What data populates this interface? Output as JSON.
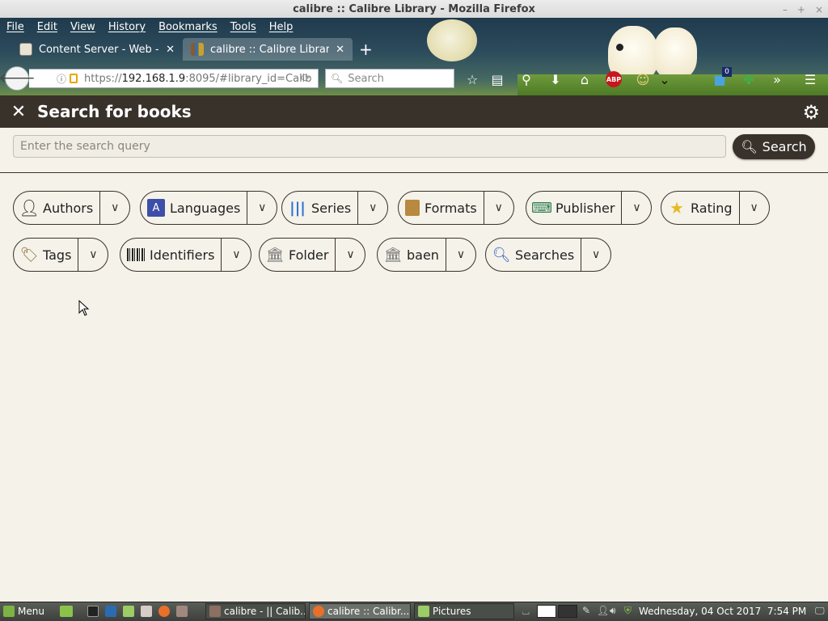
{
  "window": {
    "title": "calibre :: Calibre Library - Mozilla Firefox",
    "controls": [
      "–",
      "+",
      "×"
    ]
  },
  "menu": [
    "File",
    "Edit",
    "View",
    "History",
    "Bookmarks",
    "Tools",
    "Help"
  ],
  "tabs": [
    {
      "label": "Content Server - Web - M",
      "active": false
    },
    {
      "label": "calibre :: Calibre Library",
      "active": true
    }
  ],
  "address": {
    "prefix": "https://",
    "host": "192.168.1.9",
    "rest": ":8095/#library_id=Calib"
  },
  "search_box": {
    "placeholder": "Search"
  },
  "toolbar": {
    "badge_count": "0",
    "adblock_label": "ABP"
  },
  "app": {
    "title": "Search for books",
    "search_placeholder": "Enter the search query",
    "search_button": "Search"
  },
  "facets": [
    {
      "label": "Authors",
      "icon": "person-icon"
    },
    {
      "label": "Languages",
      "icon": "languages-icon"
    },
    {
      "label": "Series",
      "icon": "series-icon"
    },
    {
      "label": "Formats",
      "icon": "book-icon"
    },
    {
      "label": "Publisher",
      "icon": "typewriter-icon"
    },
    {
      "label": "Rating",
      "icon": "star-icon"
    },
    {
      "label": "Tags",
      "icon": "tag-icon"
    },
    {
      "label": "Identifiers",
      "icon": "barcode-icon"
    },
    {
      "label": "Folder",
      "icon": "column-icon"
    },
    {
      "label": "baen",
      "icon": "column-icon"
    },
    {
      "label": "Searches",
      "icon": "magnifier-icon"
    }
  ],
  "taskbar": {
    "menu_label": "Menu",
    "windows": [
      {
        "label": "calibre - || Calib..."
      },
      {
        "label": "calibre :: Calibr..."
      },
      {
        "label": "Pictures"
      }
    ],
    "clock": "Wednesday, 04 Oct 2017  7:54 PM"
  },
  "colors": {
    "header": "#39322b",
    "page_bg": "#f5f2e9",
    "accent_btn": "#39322b"
  }
}
